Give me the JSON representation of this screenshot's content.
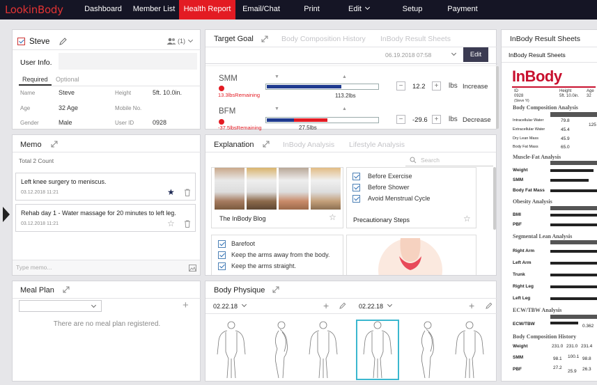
{
  "app": {
    "logo": "LookinBody"
  },
  "nav": {
    "items": [
      {
        "label": "Dashboard"
      },
      {
        "label": "Member List"
      },
      {
        "label": "Health Report"
      },
      {
        "label": "Email/Chat"
      },
      {
        "label": "Print"
      },
      {
        "label": "Edit"
      },
      {
        "label": "Setup"
      },
      {
        "label": "Payment"
      }
    ],
    "active": "Health Report"
  },
  "user": {
    "name": "Steve",
    "group_count": "(1)",
    "section": "User Info.",
    "tabs": [
      "Required",
      "Optional"
    ],
    "fields": {
      "name_label": "Name",
      "name": "Steve",
      "height_label": "Height",
      "height": "5ft. 10.0in.",
      "age_label": "Age",
      "age": "32 Age",
      "mobile_label": "Mobile No.",
      "mobile": "",
      "gender_label": "Gender",
      "gender": "Male",
      "userid_label": "User ID",
      "userid": "0928"
    }
  },
  "memo": {
    "title": "Memo",
    "count": "Total 2 Count",
    "items": [
      {
        "text": "Left knee surgery to meniscus.",
        "date": "03.12.2018 11:21",
        "starred": true
      },
      {
        "text": "Rehab day 1 - Water massage for 20 minutes to left leg.",
        "date": "03.12.2018 11:21",
        "starred": false
      }
    ],
    "placeholder": "Type memo..."
  },
  "meal": {
    "title": "Meal Plan",
    "empty": "There are no meal plan registered."
  },
  "target": {
    "tabs": [
      "Target Goal",
      "Body Composition History",
      "InBody Result Sheets"
    ],
    "date": "06.19.2018 07:58",
    "edit_label": "Edit",
    "rows": [
      {
        "label": "SMM",
        "remaining": "13.3lbsRemaining",
        "current": "113.2lbs",
        "value": "12.2",
        "unit": "lbs",
        "direction": "Increase",
        "fill_pct": 68,
        "color": "#1f3b8f"
      },
      {
        "label": "BFM",
        "remaining": "-37.5lbsRemaining",
        "current": "27.5lbs",
        "value": "-29.6",
        "unit": "lbs",
        "direction": "Decrease",
        "fill_pct": 55,
        "color": "#e31b23"
      }
    ]
  },
  "explanation": {
    "tabs": [
      "Explanation",
      "InBody Analysis",
      "Lifestyle Analysis"
    ],
    "search_placeholder": "Search",
    "blog_title": "The InBody Blog",
    "precaution_items": [
      "Before Exercise",
      "Before Shower",
      "Avoid Menstrual Cycle"
    ],
    "precaution_title": "Precautionary Steps",
    "posture_items": [
      "Barefoot",
      "Keep the arms away from the body.",
      "Keep the arms straight."
    ]
  },
  "physique": {
    "title": "Body Physique",
    "date_left": "02.22.18",
    "date_right": "02.22.18"
  },
  "result": {
    "title": "InBody Result Sheets",
    "subtitle": "InBody Result Sheets",
    "brand": "InBody",
    "id_label": "ID",
    "id_value": "0928",
    "id_name": "(Steve Yi)",
    "height_label": "Height",
    "height_value": "5ft. 10.0in.",
    "age_label": "Age",
    "age_value": "32",
    "sections": [
      "Body Composition Analysis",
      "Muscle-Fat Analysis",
      "Obesity Analysis",
      "Segmental Lean Analysis",
      "ECW/TBW Analysis",
      "Body Composition History"
    ],
    "bca_rows": [
      {
        "label": "Intracellular Water",
        "value": "79.8",
        "extra": "125"
      },
      {
        "label": "Extracellular Water",
        "value": "45.4",
        "extra": ""
      },
      {
        "label": "Dry Lean Mass",
        "value": "45.9",
        "extra": ""
      },
      {
        "label": "Body Fat Mass",
        "value": "65.0",
        "extra": ""
      }
    ],
    "mfa_rows": [
      "Weight",
      "SMM",
      "Body Fat Mass"
    ],
    "obesity_rows": [
      "BMI",
      "PBF"
    ],
    "segment_rows": [
      "Right Arm",
      "Left Arm",
      "Trunk",
      "Right Leg",
      "Left Leg"
    ],
    "ecw_label": "ECW/TBW",
    "ecw_value": "0.362",
    "history_rows": [
      {
        "label": "Weight",
        "values": [
          "231.0",
          "231.0",
          "231.4"
        ]
      },
      {
        "label": "SMM",
        "values": [
          "98.1",
          "100.1",
          "98.8"
        ]
      },
      {
        "label": "PBF",
        "values": [
          "27.2",
          "25.9",
          "26.3"
        ]
      }
    ]
  }
}
